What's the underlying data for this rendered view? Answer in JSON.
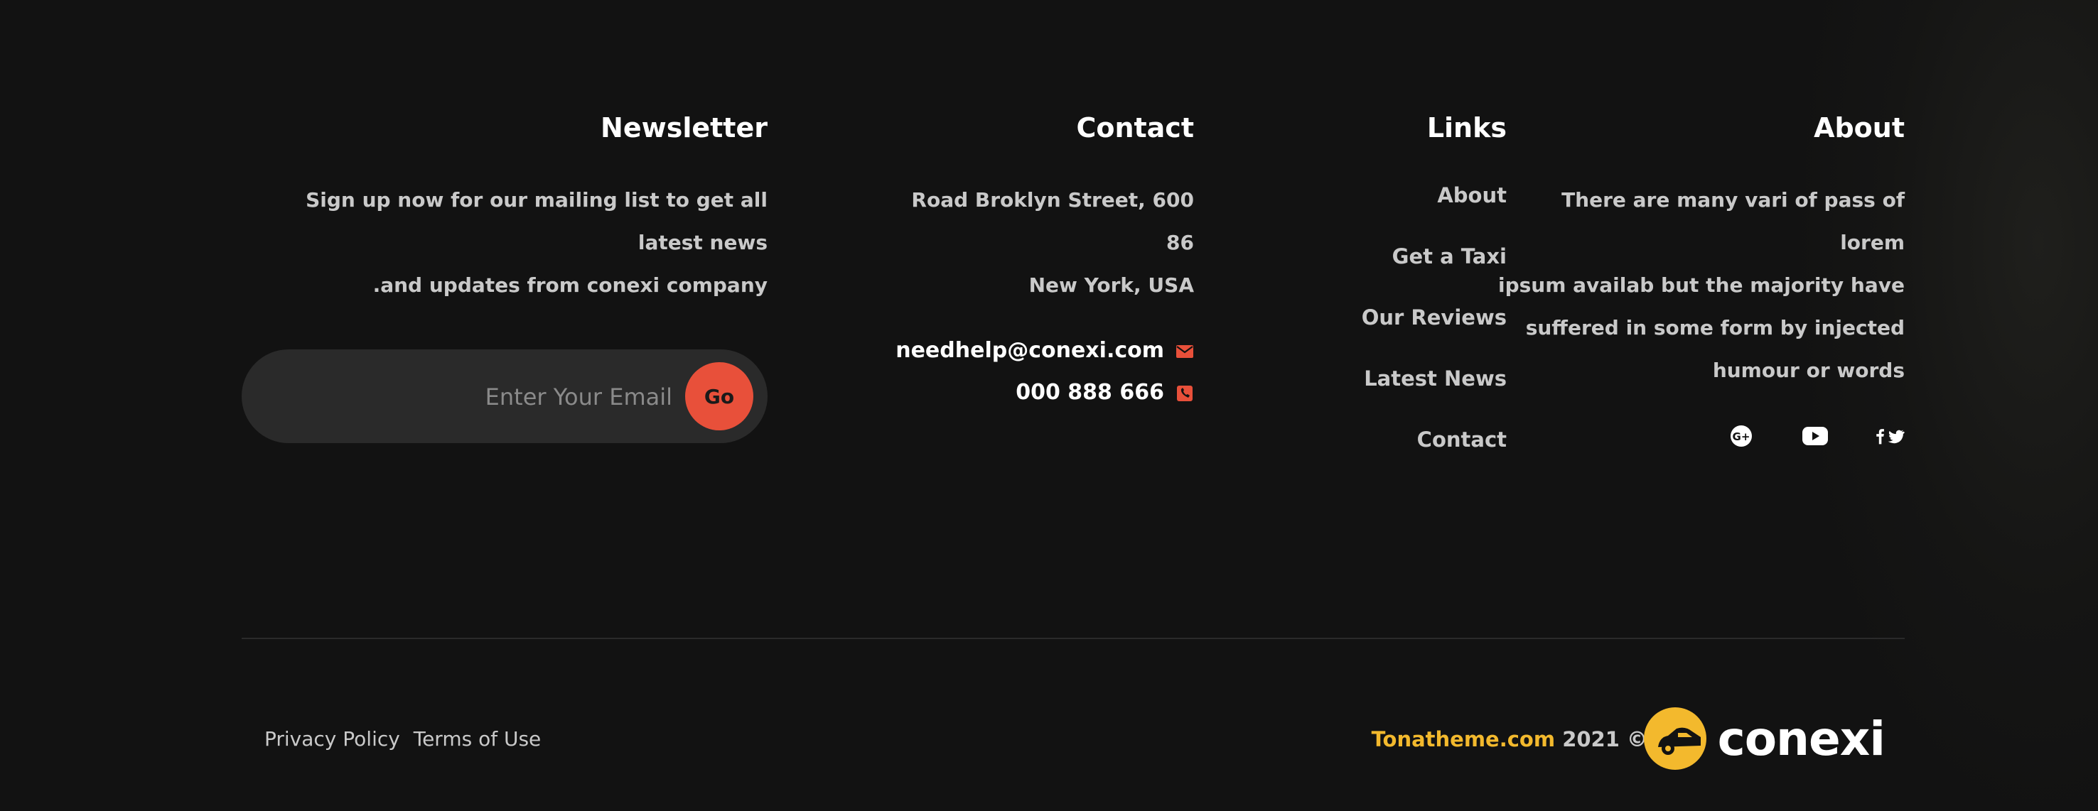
{
  "newsletter": {
    "title": "Newsletter",
    "text_line1": "Sign up now for our mailing list to get all latest news",
    "text_line2": ".and updates from conexi company",
    "email_placeholder": "Enter Your Email",
    "go_label": "Go"
  },
  "contact": {
    "title": "Contact",
    "address_line1": "Road Broklyn Street, 600 86",
    "address_line2": "New York, USA",
    "email": "needhelp@conexi.com",
    "phone": "000 888 666"
  },
  "links": {
    "title": "Links",
    "items": [
      {
        "label": "About"
      },
      {
        "label": "Get a Taxi"
      },
      {
        "label": "Our Reviews"
      },
      {
        "label": "Latest News"
      },
      {
        "label": "Contact"
      }
    ]
  },
  "about": {
    "title": "About",
    "line1": "There are many vari of pass of lorem",
    "line2": "ipsum availab but the majority have",
    "line3": "suffered in some form by injected",
    "line4": "humour or words",
    "social": [
      {
        "icon": "google-plus-icon"
      },
      {
        "icon": "youtube-icon"
      },
      {
        "icon": "facebook-twitter-icon"
      }
    ]
  },
  "bottom": {
    "privacy_label": "Privacy Policy",
    "terms_label": "Terms of Use",
    "brand_link": "Tonatheme.com",
    "copyright_text": "2021 ©",
    "logo_text": "conexi"
  },
  "colors": {
    "background": "#121212",
    "accent_red": "#e8503a",
    "accent_yellow": "#f3b92d",
    "text_muted": "#c9c9c9",
    "text_white": "#ffffff"
  }
}
